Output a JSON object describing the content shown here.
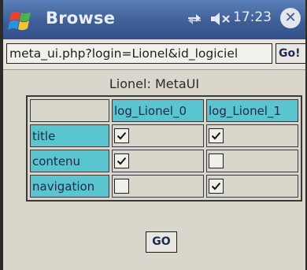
{
  "titlebar": {
    "title": "Browse",
    "time": "17:23"
  },
  "address": {
    "url": "meta_ui.php?login=Lionel&id_logiciel",
    "go_label": "Go!"
  },
  "form": {
    "caption": "Lionel: MetaUI",
    "columns": [
      "log_Lionel_0",
      "log_Lionel_1"
    ],
    "rows": [
      {
        "label": "title",
        "checks": [
          true,
          true
        ]
      },
      {
        "label": "contenu",
        "checks": [
          true,
          false
        ]
      },
      {
        "label": "navigation",
        "checks": [
          false,
          true
        ]
      }
    ],
    "submit_label": "GO"
  },
  "colors": {
    "titlebar": "#3f5f97",
    "header_cell": "#5ac4d1",
    "background": "#d9d6cc"
  }
}
